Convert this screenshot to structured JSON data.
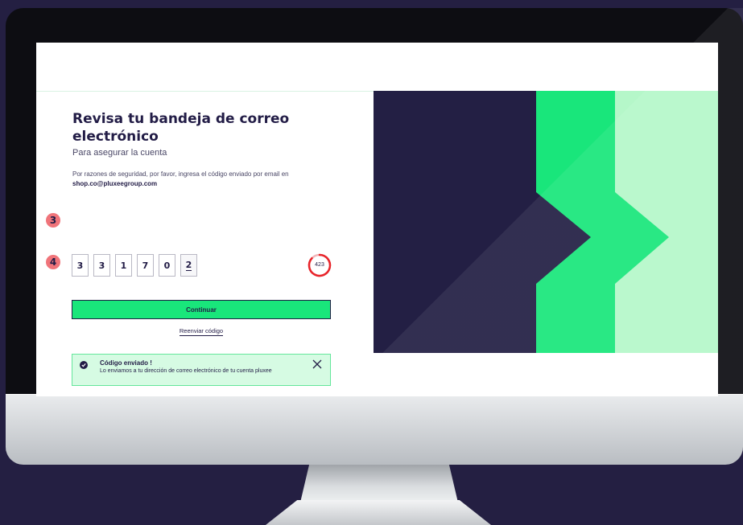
{
  "page": {
    "title": "Revisa tu bandeja de correo electrónico",
    "subtitle": "Para asegurar la cuenta",
    "note_text": "Por razones de seguridad, por favor, ingresa el código enviado por email en",
    "email": "shop.co@pluxeegroup.com"
  },
  "code": {
    "digits": [
      "3",
      "3",
      "1",
      "7",
      "0",
      "2"
    ],
    "timer": "423"
  },
  "steps": {
    "step_code": "3",
    "step_continue": "4"
  },
  "actions": {
    "continue_label": "Continuar",
    "resend_label": "Reenviar código"
  },
  "toast": {
    "title": "Código enviado !",
    "message": "Lo enviamos a tu dirección de correo electrónico de tu cuenta pluxee"
  },
  "icons": {
    "toast": "check-circle-icon",
    "close": "close-icon",
    "timer": "countdown-ring-icon"
  },
  "colors": {
    "brand_navy": "#221c46",
    "brand_green": "#19e67b",
    "light_green": "#b5f7c9",
    "badge_coral": "#f0747a",
    "timer_red": "#e8242a"
  }
}
